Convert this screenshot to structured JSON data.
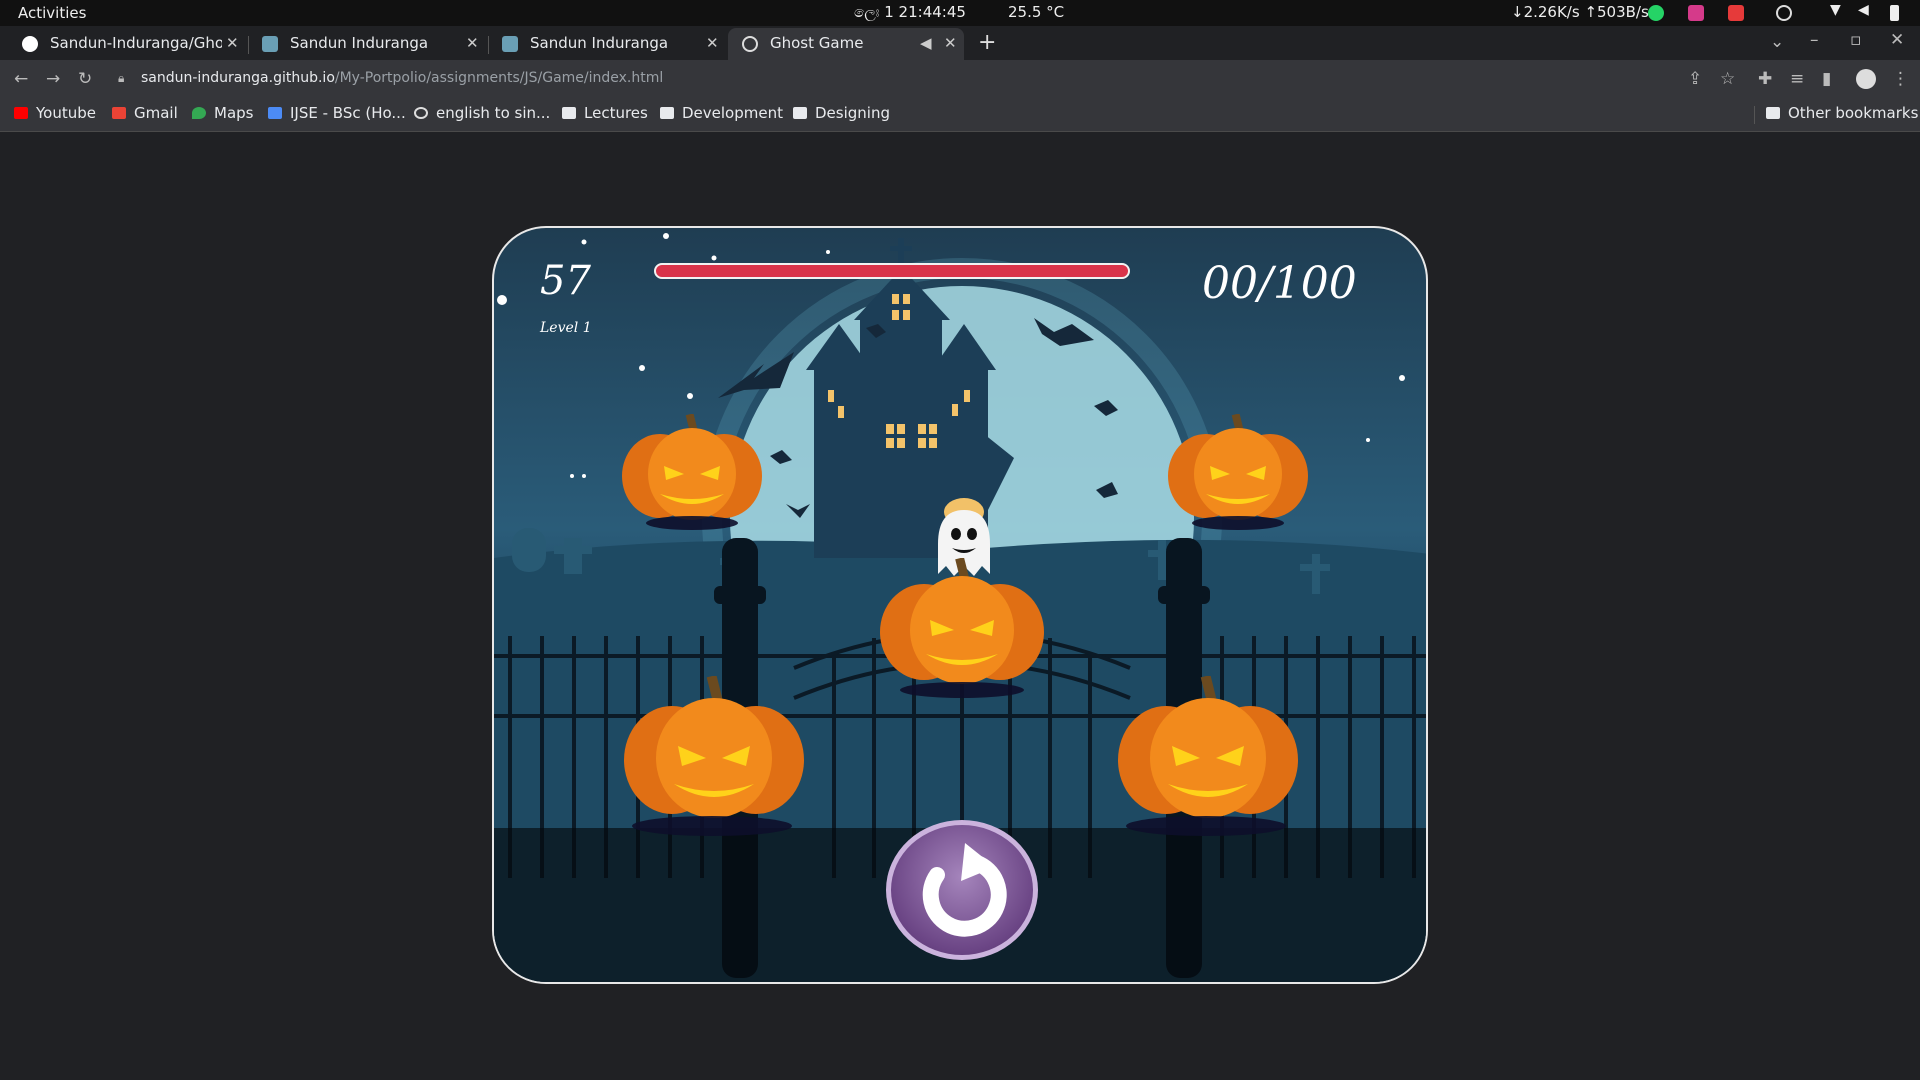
{
  "system_bar": {
    "activities": "Activities",
    "clock": "ලෙඃ 1  21:44:45",
    "weather": "25.5 °C",
    "network": "↓2.26K/s ↑503B/s"
  },
  "tabs": [
    {
      "title": "Sandun-Induranga/Ghost"
    },
    {
      "title": "Sandun Induranga"
    },
    {
      "title": "Sandun Induranga"
    },
    {
      "title": "Ghost Game"
    }
  ],
  "address": {
    "host": "sandun-induranga.github.io",
    "path": "/My-Portpolio/assignments/JS/Game/index.html"
  },
  "bookmarks": [
    "Youtube",
    "Gmail",
    "Maps",
    "IJSE - BSc (Ho...",
    "english to sin...",
    "Lectures",
    "Development",
    "Designing"
  ],
  "other_bookmarks": "Other bookmarks",
  "game": {
    "timer": "57",
    "level": "Level 1",
    "score": "00/100",
    "health_fraction": 1.0
  },
  "colors": {
    "health_bar": "#d9334a",
    "pumpkin": "#f28a1c",
    "restart": "#7a5096"
  },
  "icons": {
    "restart": "restart-icon",
    "ghost": "ghost-icon"
  }
}
